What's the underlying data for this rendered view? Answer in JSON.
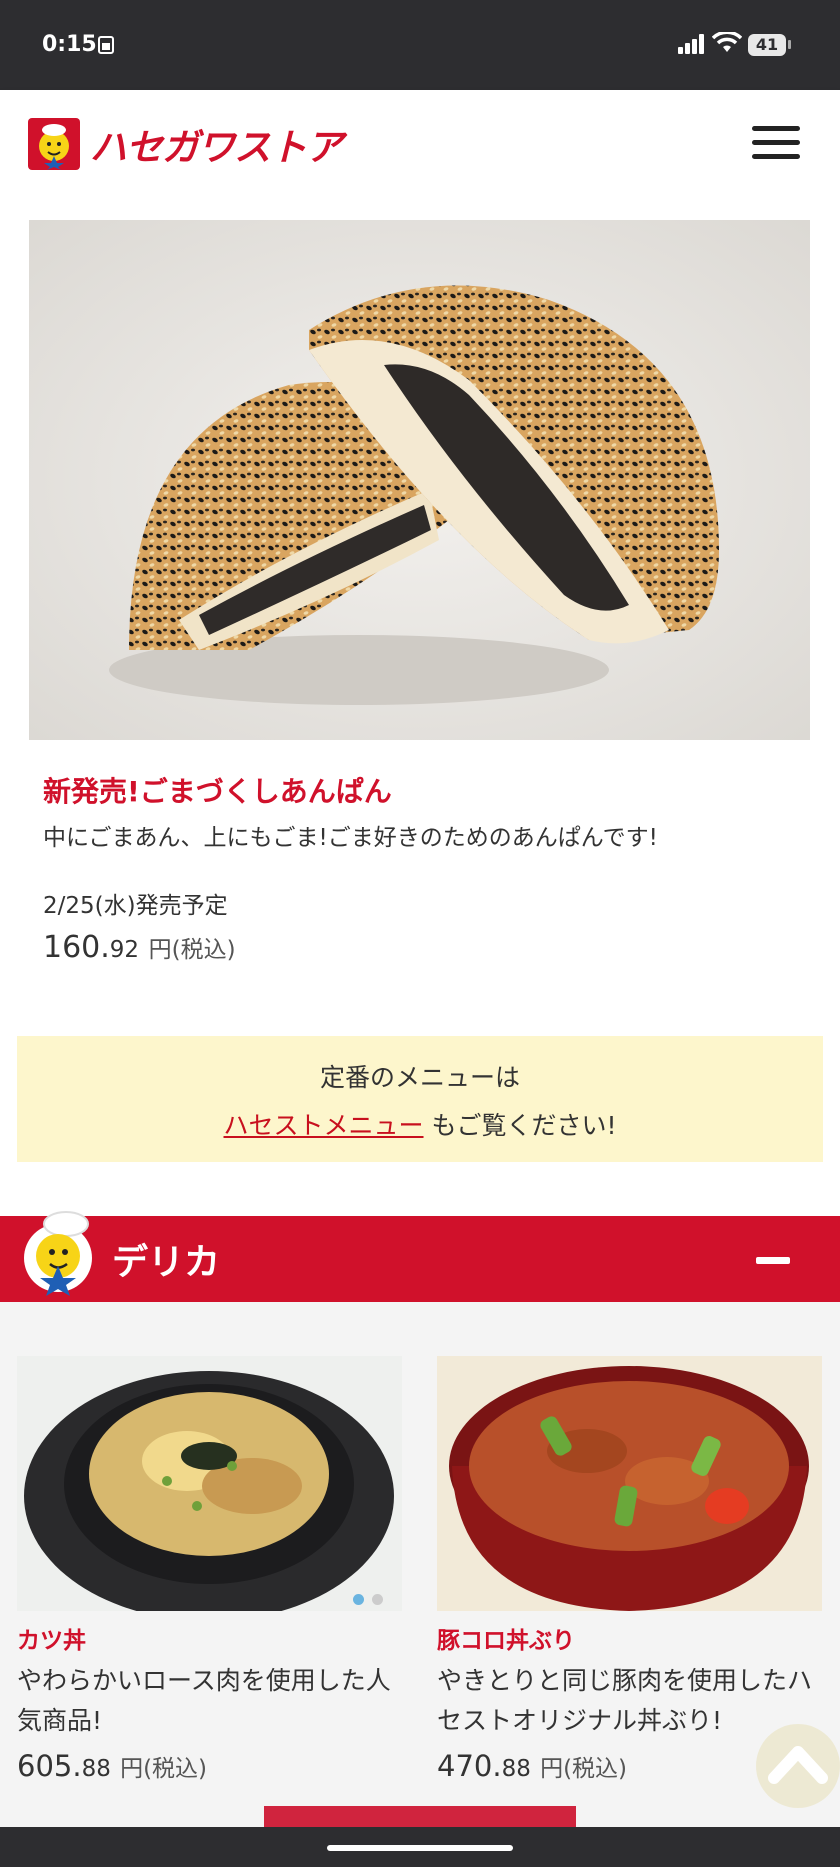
{
  "status_bar": {
    "time": "0:15",
    "battery": "41"
  },
  "header": {
    "logo_text": "ハセガワストア"
  },
  "promo": {
    "title": "新発売!ごまづくしあんぱん",
    "description": "中にごまあん、上にもごま!ごま好きのためのあんぱんです!",
    "release_date": "2/25(水)発売予定",
    "price_int": "160.",
    "price_dec": "92",
    "price_unit": "円(税込)"
  },
  "notice": {
    "line1": "定番のメニューは",
    "link": "ハセストメニュー",
    "line2_suffix": " もご覧ください!"
  },
  "section": {
    "title": "デリカ"
  },
  "items": [
    {
      "name": "カツ丼",
      "description": "やわらかいロース肉を使用した人気商品!",
      "price_int": "605.",
      "price_dec": "88",
      "price_unit": "円(税込)"
    },
    {
      "name": "豚コロ丼ぶり",
      "description": "やきとりと同じ豚肉を使用したハセストオリジナル丼ぶり!",
      "price_int": "470.",
      "price_dec": "88",
      "price_unit": "円(税込)"
    }
  ],
  "colors": {
    "brand_red": "#d0112b",
    "notice_bg": "#fdf6cc"
  }
}
